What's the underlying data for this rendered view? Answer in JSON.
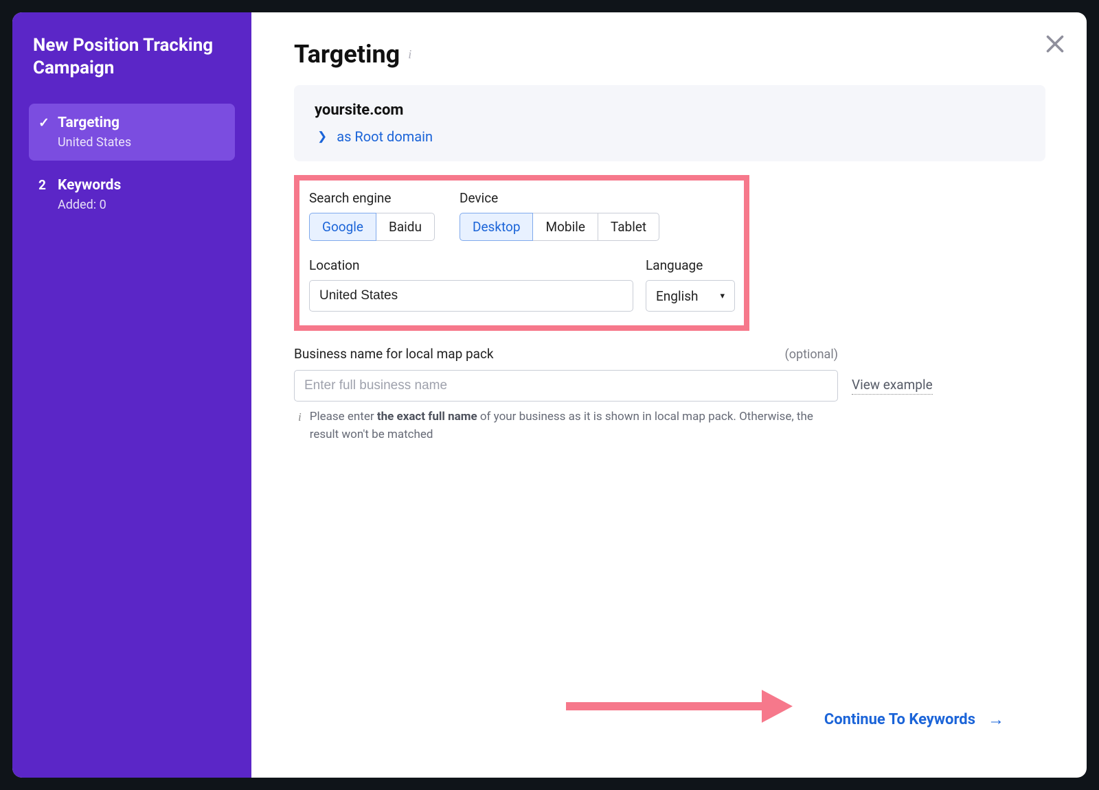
{
  "sidebar": {
    "title": "New Position Tracking Campaign",
    "steps": [
      {
        "index": "✓",
        "label": "Targeting",
        "sub": "United States",
        "active": true
      },
      {
        "index": "2",
        "label": "Keywords",
        "sub": "Added: 0",
        "active": false
      }
    ]
  },
  "main": {
    "title": "Targeting",
    "domain_card": {
      "domain": "yoursite.com",
      "link_text": "as Root domain"
    },
    "search_engine": {
      "label": "Search engine",
      "options": [
        "Google",
        "Baidu"
      ],
      "selected": "Google"
    },
    "device": {
      "label": "Device",
      "options": [
        "Desktop",
        "Mobile",
        "Tablet"
      ],
      "selected": "Desktop"
    },
    "location": {
      "label": "Location",
      "value": "United States"
    },
    "language": {
      "label": "Language",
      "value": "English"
    },
    "business": {
      "label": "Business name for local map pack",
      "optional": "(optional)",
      "placeholder": "Enter full business name",
      "view_example": "View example",
      "help_pre": "Please enter ",
      "help_strong": "the exact full name",
      "help_post": " of your business as it is shown in local map pack. Otherwise, the result won't be matched"
    },
    "continue": "Continue To Keywords"
  }
}
